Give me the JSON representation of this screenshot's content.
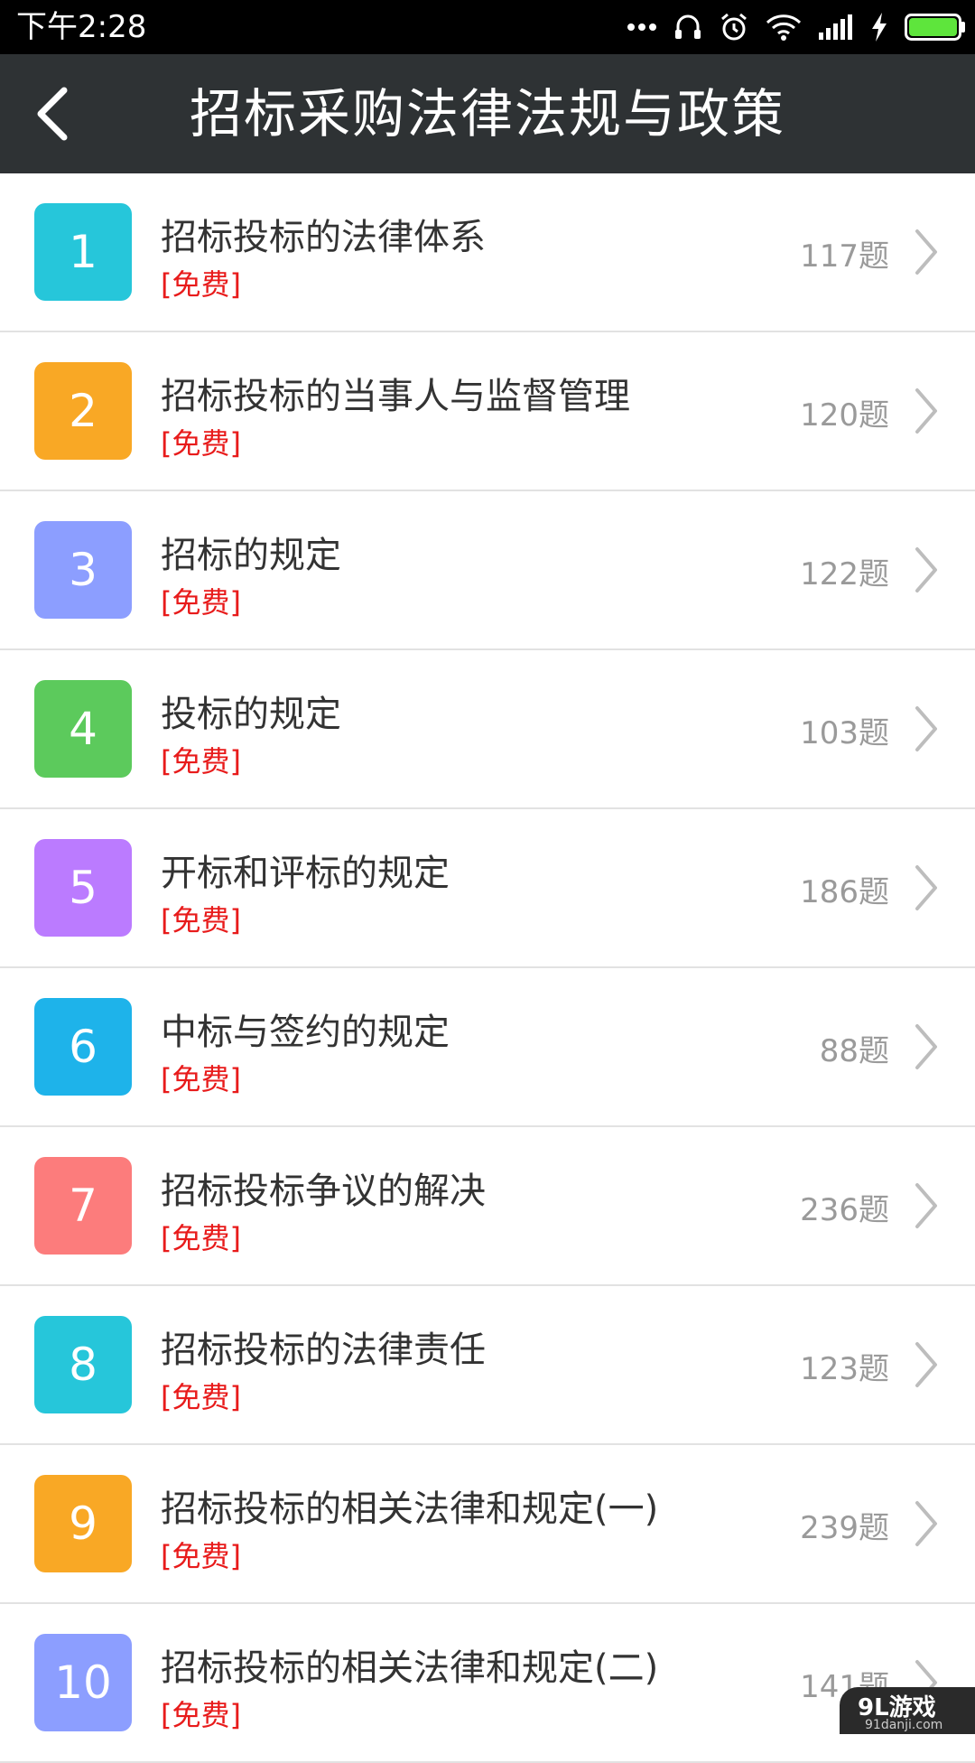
{
  "status_bar": {
    "time": "下午2:28",
    "icons": [
      "more-icon",
      "headset-icon",
      "alarm-icon",
      "wifi-icon",
      "signal-icon",
      "charging-icon",
      "battery-icon"
    ]
  },
  "header": {
    "title": "招标采购法律法规与政策",
    "back_icon": "back-arrow-icon",
    "background": "#2e3234"
  },
  "items": [
    {
      "num": "1",
      "title": "招标投标的法律体系",
      "tag": "[免费]",
      "count": "117题",
      "color": "#26c6da"
    },
    {
      "num": "2",
      "title": "招标投标的当事人与监督管理",
      "tag": "[免费]",
      "count": "120题",
      "color": "#f9a825"
    },
    {
      "num": "3",
      "title": "招标的规定",
      "tag": "[免费]",
      "count": "122题",
      "color": "#8c9eff"
    },
    {
      "num": "4",
      "title": "投标的规定",
      "tag": "[免费]",
      "count": "103题",
      "color": "#5cca5c"
    },
    {
      "num": "5",
      "title": "开标和评标的规定",
      "tag": "[免费]",
      "count": "186题",
      "color": "#bb7bff"
    },
    {
      "num": "6",
      "title": "中标与签约的规定",
      "tag": "[免费]",
      "count": "88题",
      "color": "#1eb3ea"
    },
    {
      "num": "7",
      "title": "招标投标争议的解决",
      "tag": "[免费]",
      "count": "236题",
      "color": "#fc7c7c"
    },
    {
      "num": "8",
      "title": "招标投标的法律责任",
      "tag": "[免费]",
      "count": "123题",
      "color": "#26c6da"
    },
    {
      "num": "9",
      "title": "招标投标的相关法律和规定(一)",
      "tag": "[免费]",
      "count": "239题",
      "color": "#f9a825"
    },
    {
      "num": "10",
      "title": "招标投标的相关法律和规定(二)",
      "tag": "[免费]",
      "count": "141题",
      "color": "#8c9eff"
    }
  ],
  "colors": {
    "tag_red": "#e81b1b",
    "count_gray": "#9a9a9a",
    "divider": "#e2e2e2"
  },
  "watermark": {
    "logo": "9L游戏",
    "site": "91danji.com"
  }
}
